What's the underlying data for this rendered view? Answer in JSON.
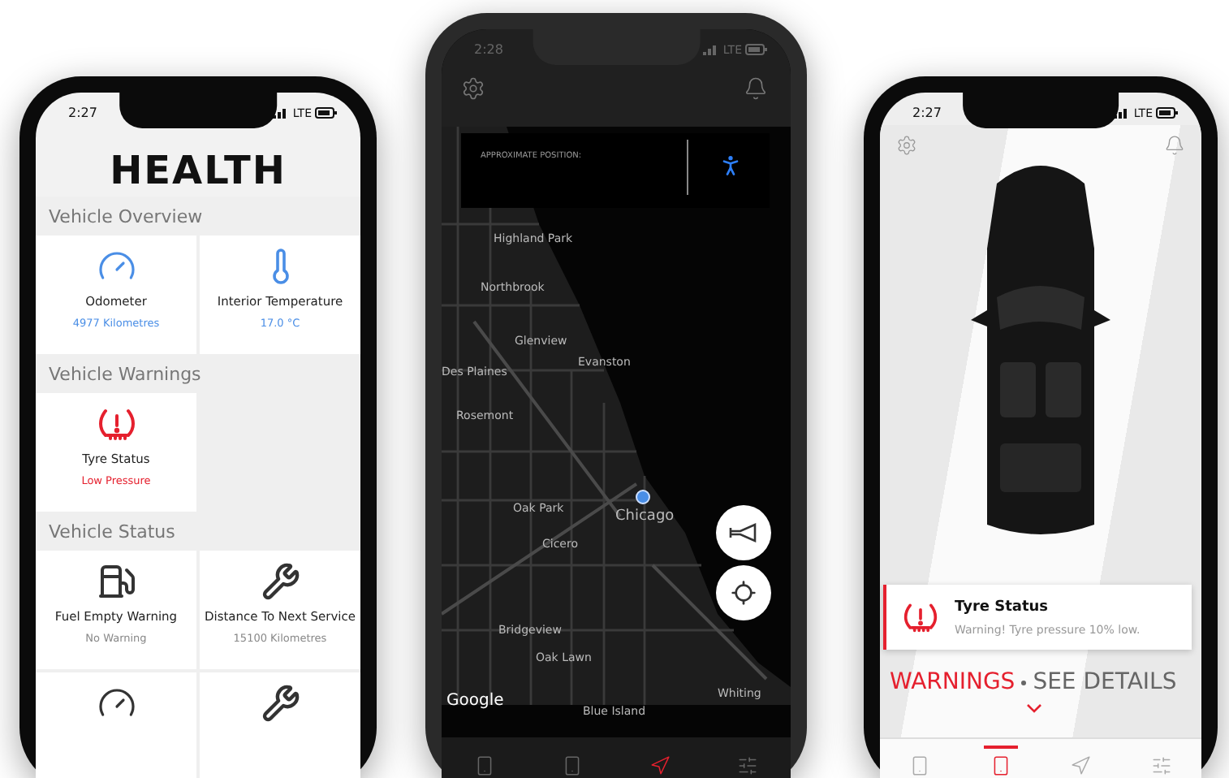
{
  "phones": [
    {
      "kind": "health",
      "status_bar": {
        "time": "2:27",
        "network": "LTE"
      },
      "title": "HEALTH",
      "sections": [
        {
          "heading": "Vehicle Overview",
          "tiles": [
            {
              "kind": "gauge",
              "label": "Odometer",
              "value": "4977 Kilometres",
              "color": "#4a8ee6"
            },
            {
              "kind": "thermometer",
              "label": "Interior Temperature",
              "value": "17.0 °C",
              "color": "#4a8ee6"
            }
          ]
        },
        {
          "heading": "Vehicle Warnings",
          "tiles": [
            {
              "kind": "tyre",
              "label": "Tyre Status",
              "value": "Low Pressure",
              "color": "#e5202e"
            }
          ]
        },
        {
          "heading": "Vehicle Status",
          "tiles": [
            {
              "kind": "fuel",
              "label": "Fuel Empty Warning",
              "value": "No Warning",
              "color": "#888888"
            },
            {
              "kind": "wrench",
              "label": "Distance To Next Service",
              "value": "15100 Kilometres",
              "color": "#888888"
            },
            {
              "kind": "gauge"
            },
            {
              "kind": "wrench"
            }
          ]
        }
      ]
    },
    {
      "kind": "map",
      "status_bar": {
        "time": "2:28",
        "network": "LTE"
      },
      "position_label": "APPROXIMATE POSITION:",
      "places": [
        "Highland Park",
        "Northbrook",
        "Glenview",
        "Evanston",
        "Des Plaines",
        "Rosemont",
        "Oak Park",
        "Chicago",
        "Cicero",
        "Bridgeview",
        "Oak Lawn",
        "Blue Island",
        "Whiting"
      ],
      "attribution": "Google",
      "nav": [
        {
          "selected": false
        },
        {
          "selected": false
        },
        {
          "selected": true
        },
        {
          "selected": false
        }
      ]
    },
    {
      "kind": "car",
      "status_bar": {
        "time": "2:27",
        "network": "LTE"
      },
      "notification": {
        "title": "Tyre Status",
        "message": "Warning! Tyre pressure 10% low."
      },
      "links": [
        {
          "label": "WARNINGS",
          "selected": true
        },
        {
          "label": "SEE DETAILS",
          "selected": false
        }
      ],
      "nav": [
        {
          "selected": false
        },
        {
          "selected": true
        },
        {
          "selected": false
        },
        {
          "selected": false
        }
      ]
    }
  ]
}
